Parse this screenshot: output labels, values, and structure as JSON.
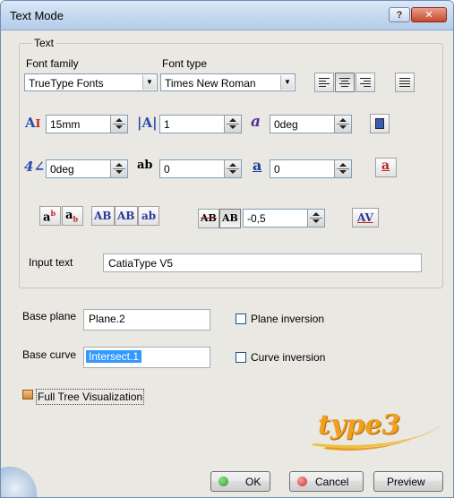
{
  "window": {
    "title": "Text Mode",
    "help_label": "?",
    "close_label": "✕"
  },
  "text_group": {
    "legend": "Text",
    "font_family_label": "Font family",
    "font_family_value": "TrueType Fonts",
    "font_type_label": "Font type",
    "font_type_value": "Times New Roman",
    "alignment_icons": [
      "align-left-icon",
      "align-center-icon",
      "align-right-icon",
      "justify-icon"
    ],
    "height_value": "15mm",
    "ratio_value": "1",
    "slant_value": "0deg",
    "rotation_value": "0deg",
    "spacing_value": "0",
    "underline_offset_value": "0",
    "char_ratio_value": "-0,5",
    "style_glyphs": {
      "superscript": "a",
      "subscript": "a",
      "caps1": "AB",
      "caps2": "AB",
      "lower": "ab",
      "strike": "AB",
      "strike2": "AB",
      "italic_a": "a",
      "underline_a": "a",
      "underline_a2": "a",
      "av": "AV",
      "spacing_ab": "ab"
    },
    "input_text_label": "Input text",
    "input_text_value": "CatiaType V5"
  },
  "base_plane": {
    "label": "Base plane",
    "value": "Plane.2",
    "inversion_label": "Plane inversion"
  },
  "base_curve": {
    "label": "Base curve",
    "value": "Intersect.1",
    "inversion_label": "Curve inversion"
  },
  "full_tree_label": "Full Tree Visualization",
  "logo_text": "type3",
  "buttons": {
    "ok": "OK",
    "cancel": "Cancel",
    "preview": "Preview"
  },
  "colors": {
    "ok_dot": "#2a9a2a",
    "cancel_dot": "#c8322a",
    "logo_orange": "#f0a020"
  }
}
